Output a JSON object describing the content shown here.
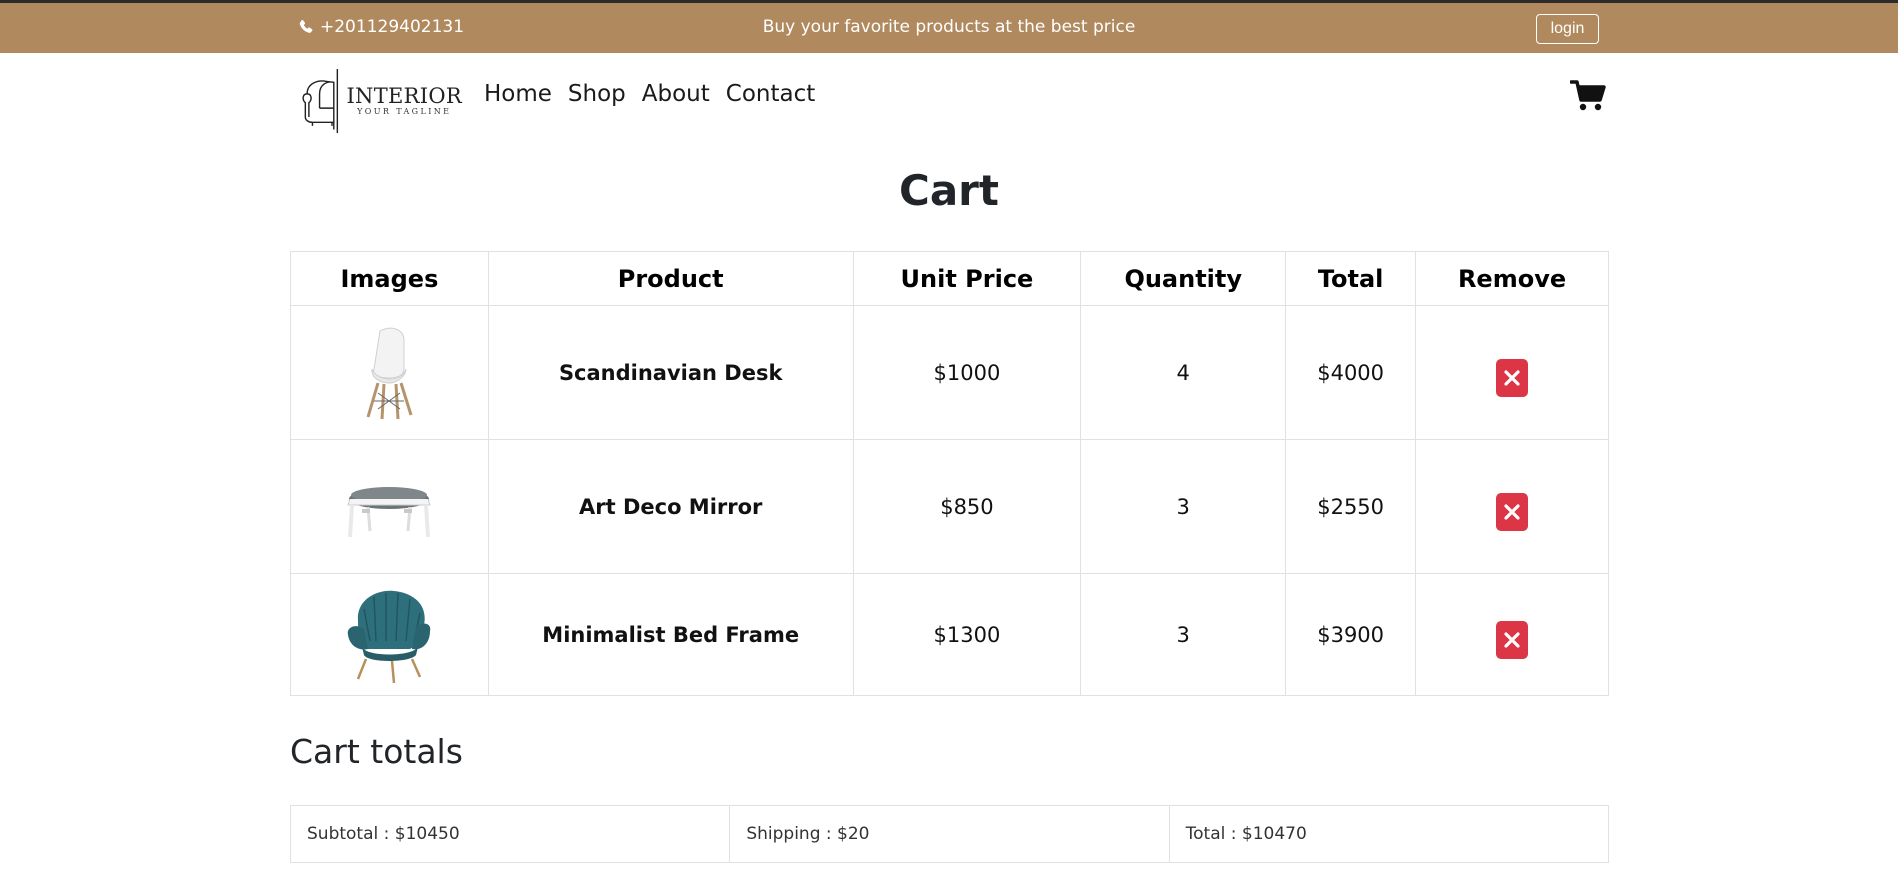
{
  "topbar": {
    "phone": "+201129402131",
    "promo": "Buy your favorite products at the best price",
    "login_label": "login",
    "background": "#b08a5e"
  },
  "nav": {
    "logo_brand": "INTERIOR",
    "logo_tagline": "YOUR TAGLINE",
    "links": [
      {
        "label": "Home"
      },
      {
        "label": "Shop"
      },
      {
        "label": "About"
      },
      {
        "label": "Contact"
      }
    ],
    "cart_icon": "shopping-cart-icon"
  },
  "page": {
    "title": "Cart"
  },
  "cart": {
    "headers": [
      "Images",
      "Product",
      "Unit Price",
      "Quantity",
      "Total",
      "Remove"
    ],
    "rows": [
      {
        "image": "white-chair-image",
        "product": "Scandinavian Desk",
        "unit_price": "$1000",
        "quantity": "4",
        "total": "$4000"
      },
      {
        "image": "grey-ottoman-image",
        "product": "Art Deco Mirror",
        "unit_price": "$850",
        "quantity": "3",
        "total": "$2550"
      },
      {
        "image": "teal-armchair-image",
        "product": "Minimalist Bed Frame",
        "unit_price": "$1300",
        "quantity": "3",
        "total": "$3900"
      }
    ],
    "remove_icon": "close-icon",
    "remove_color": "#dc3545"
  },
  "totals": {
    "title": "Cart totals",
    "subtotal": "Subtotal : $10450",
    "shipping": "Shipping : $20",
    "total": "Total : $10470"
  }
}
